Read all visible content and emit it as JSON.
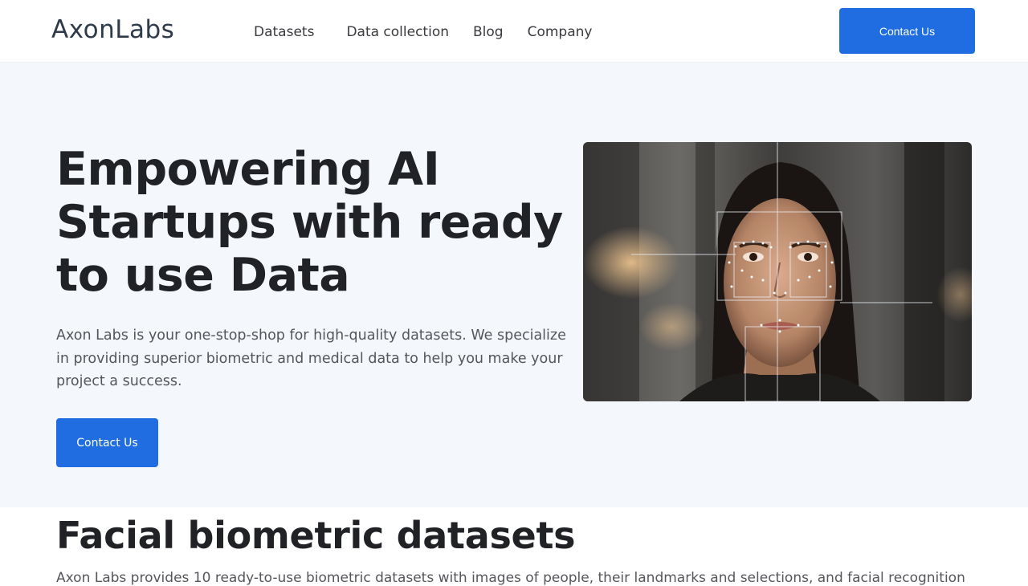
{
  "header": {
    "logo": "AxonLabs",
    "nav": [
      "Datasets",
      "Data collection",
      "Blog",
      "Company"
    ],
    "cta_label": "Contact Us"
  },
  "hero": {
    "title": "Empowering AI Startups with ready to use Data",
    "description": "Axon Labs is your one-stop-shop for high-quality datasets. We specialize in providing superior biometric and medical data to help you make your project a success.",
    "cta_label": "Contact Us",
    "image_subject": "face-recognition-photo"
  },
  "section": {
    "title": "Facial biometric datasets",
    "text": "Axon Labs provides 10 ready-to-use biometric datasets with images of people, their landmarks and selections, and facial recognition"
  },
  "colors": {
    "accent": "#1f6de0",
    "hero_bg": "#f4f7fc",
    "text_dark": "#212226",
    "text_muted": "#55565b"
  }
}
